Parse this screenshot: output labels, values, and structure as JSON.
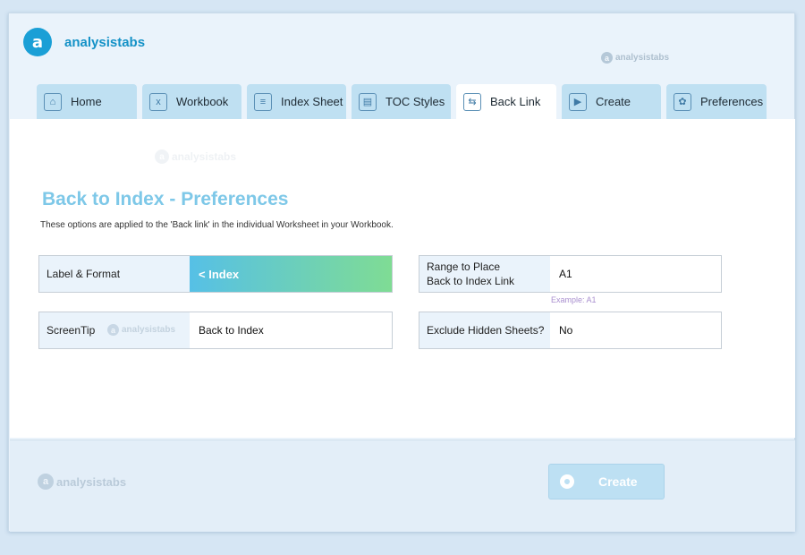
{
  "brand": {
    "logo_glyph": "a",
    "name": "analysistabs",
    "watermark": "analysistabs"
  },
  "tabs": [
    {
      "label": "Home",
      "icon": "home-icon",
      "glyph": "⌂",
      "active": false
    },
    {
      "label": "Workbook",
      "icon": "excel-file-icon",
      "glyph": "x",
      "active": false
    },
    {
      "label": "Index Sheet",
      "icon": "list-icon",
      "glyph": "≡",
      "active": false
    },
    {
      "label": "TOC Styles",
      "icon": "styles-icon",
      "glyph": "▤",
      "active": false
    },
    {
      "label": "Back Link",
      "icon": "back-link-icon",
      "glyph": "⇆",
      "active": true
    },
    {
      "label": "Create",
      "icon": "create-icon",
      "glyph": "▶",
      "active": false
    },
    {
      "label": "Preferences",
      "icon": "gear-icon",
      "glyph": "✿",
      "active": false
    }
  ],
  "main": {
    "title": "Back to Index - Preferences",
    "subtitle": "These options are applied to the 'Back link' in the individual Worksheet in your Workbook.",
    "label_format": {
      "label": "Label & Format",
      "value": "< Index"
    },
    "screentip": {
      "label": "ScreenTip",
      "value": "Back to Index"
    },
    "range": {
      "label_line1": "Range to Place",
      "label_line2": "Back to Index Link",
      "value": "A1",
      "hint": "Example: A1"
    },
    "exclude_hidden": {
      "label": "Exclude Hidden Sheets?",
      "value": "No"
    }
  },
  "footer": {
    "create_label": "Create"
  },
  "colors": {
    "accent": "#1a9fd6",
    "title": "#7ec8e8",
    "gradient_start": "#56c0e6",
    "gradient_end": "#7fdc94"
  }
}
